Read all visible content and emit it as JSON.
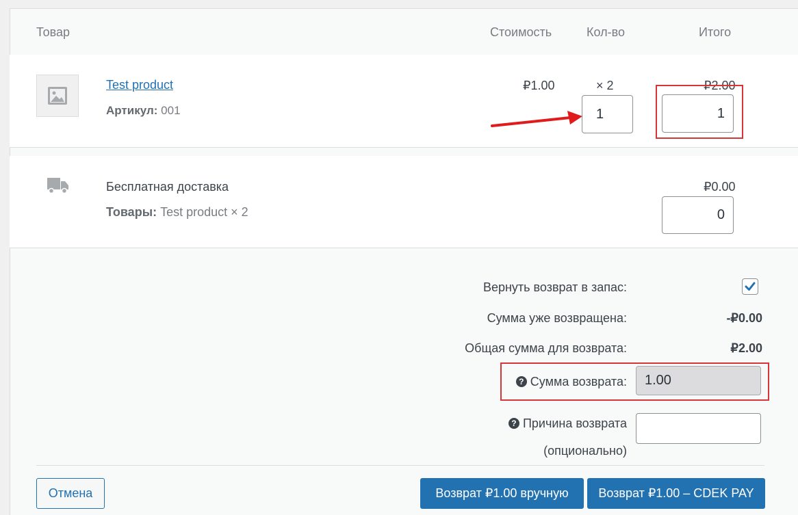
{
  "table": {
    "headers": {
      "product": "Товар",
      "cost": "Стоимость",
      "qty": "Кол-во",
      "total": "Итого"
    }
  },
  "item": {
    "name": "Test product",
    "sku_label": "Артикул:",
    "sku_value": "001",
    "cost": "₽1.00",
    "qty": "× 2",
    "total": "₽2.00",
    "refund_qty": "1",
    "refund_total": "1"
  },
  "shipping": {
    "name": "Бесплатная доставка",
    "items_label": "Товары:",
    "items_value": "Test product × 2",
    "total": "₽0.00",
    "refund_total": "0"
  },
  "refund": {
    "restock_label": "Вернуть возврат в запас:",
    "restock_checked": true,
    "already_refunded_label": "Сумма уже возвращена:",
    "already_refunded_value": "-₽0.00",
    "available_label": "Общая сумма для возврата:",
    "available_value": "₽2.00",
    "amount_label": "Сумма возврата:",
    "amount_value": "1.00",
    "reason_label_line1": "Причина возврата",
    "reason_label_line2": "(опционально)",
    "reason_value": ""
  },
  "buttons": {
    "cancel": "Отмена",
    "manual": "Возврат ₽1.00 вручную",
    "gateway": "Возврат ₽1.00 – CDEK PAY"
  },
  "icons": {
    "help": "?",
    "check": "✓"
  },
  "colors": {
    "accent": "#2271b1",
    "highlight": "#d63638",
    "annotation_arrow": "#e01b1b"
  }
}
